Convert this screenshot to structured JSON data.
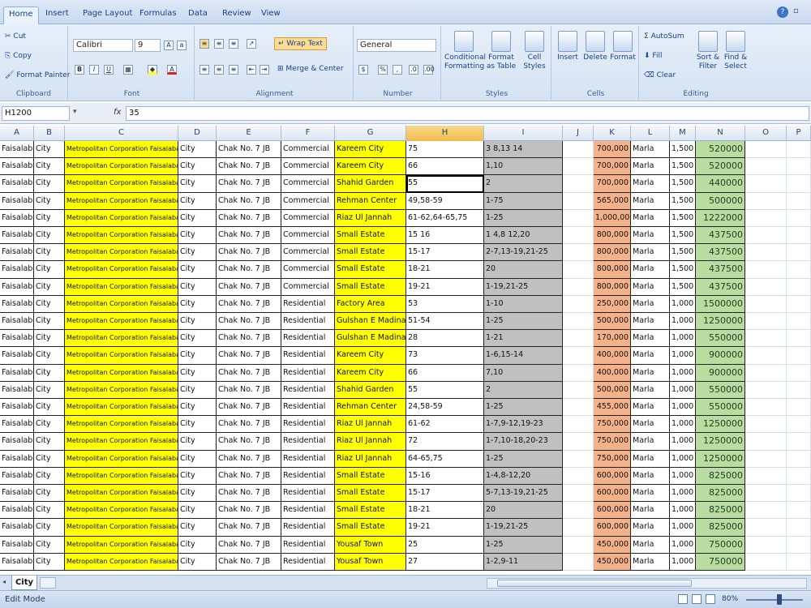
{
  "tabs": [
    "Home",
    "Insert",
    "Page Layout",
    "Formulas",
    "Data",
    "Review",
    "View"
  ],
  "ribbon": {
    "clipboard": {
      "cut": "Cut",
      "copy": "Copy",
      "format_painter": "Format Painter",
      "label": "Clipboard"
    },
    "font": {
      "name": "Calibri",
      "size": "9",
      "label": "Font"
    },
    "alignment": {
      "wrap": "Wrap Text",
      "merge": "Merge & Center",
      "label": "Alignment"
    },
    "number": {
      "format": "General",
      "label": "Number"
    },
    "styles": {
      "conditional": "Conditional Formatting",
      "format_table": "Format as Table",
      "cell_styles": "Cell Styles",
      "label": "Styles"
    },
    "cells": {
      "insert": "Insert",
      "delete": "Delete",
      "format": "Format",
      "label": "Cells"
    },
    "editing": {
      "autosum": "AutoSum",
      "fill": "Fill",
      "clear": "Clear",
      "sort": "Sort & Filter",
      "find": "Find & Select",
      "label": "Editing"
    }
  },
  "formula_bar": {
    "name_box": "H1200",
    "fx": "fx",
    "content": "35"
  },
  "columns": [
    "A",
    "B",
    "C",
    "D",
    "E",
    "F",
    "G",
    "H",
    "I",
    "J",
    "K",
    "L",
    "M",
    "N",
    "O",
    "P"
  ],
  "selected_column": "H",
  "rows": [
    {
      "a": "Faisalabad",
      "b": "City",
      "c": "Metropolitan Corporation Faisalabad",
      "d": "City",
      "e": "Chak No. 7 JB",
      "f": "Commercial",
      "g": "Kareem City",
      "h": "75",
      "i": "3 8,13 14",
      "k": "700,000",
      "l": "Marla",
      "m": "1,500",
      "n": "520000"
    },
    {
      "a": "Faisalabad",
      "b": "City",
      "c": "Metropolitan Corporation Faisalabad",
      "d": "City",
      "e": "Chak No. 7 JB",
      "f": "Commercial",
      "g": "Kareem City",
      "h": "66",
      "i": "1,10",
      "k": "700,000",
      "l": "Marla",
      "m": "1,500",
      "n": "520000"
    },
    {
      "a": "Faisalabad",
      "b": "City",
      "c": "Metropolitan Corporation Faisalabad",
      "d": "City",
      "e": "Chak No. 7 JB",
      "f": "Commercial",
      "g": "Shahid Garden",
      "h": "55",
      "i": "2",
      "k": "700,000",
      "l": "Marla",
      "m": "1,500",
      "n": "440000"
    },
    {
      "a": "Faisalabad",
      "b": "City",
      "c": "Metropolitan Corporation Faisalabad",
      "d": "City",
      "e": "Chak No. 7 JB",
      "f": "Commercial",
      "g": "Rehman Center",
      "h": "49,58-59",
      "i": "1-75",
      "k": "565,000",
      "l": "Marla",
      "m": "1,500",
      "n": "500000"
    },
    {
      "a": "Faisalabad",
      "b": "City",
      "c": "Metropolitan Corporation Faisalabad",
      "d": "City",
      "e": "Chak No. 7 JB",
      "f": "Commercial",
      "g": "Riaz Ul Jannah",
      "h": "61-62,64-65,75",
      "i": "1-25",
      "k": "1,000,000",
      "l": "Marla",
      "m": "1,500",
      "n": "1222000"
    },
    {
      "a": "Faisalabad",
      "b": "City",
      "c": "Metropolitan Corporation Faisalabad",
      "d": "City",
      "e": "Chak No. 7 JB",
      "f": "Commercial",
      "g": "Small Estate",
      "h": "15 16",
      "i": "1 4,8 12,20",
      "k": "800,000",
      "l": "Marla",
      "m": "1,500",
      "n": "437500"
    },
    {
      "a": "Faisalabad",
      "b": "City",
      "c": "Metropolitan Corporation Faisalabad",
      "d": "City",
      "e": "Chak No. 7 JB",
      "f": "Commercial",
      "g": "Small Estate",
      "h": "15-17",
      "i": "2-7,13-19,21-25",
      "k": "800,000",
      "l": "Marla",
      "m": "1,500",
      "n": "437500"
    },
    {
      "a": "Faisalabad",
      "b": "City",
      "c": "Metropolitan Corporation Faisalabad",
      "d": "City",
      "e": "Chak No. 7 JB",
      "f": "Commercial",
      "g": "Small Estate",
      "h": "18-21",
      "i": "20",
      "k": "800,000",
      "l": "Marla",
      "m": "1,500",
      "n": "437500"
    },
    {
      "a": "Faisalabad",
      "b": "City",
      "c": "Metropolitan Corporation Faisalabad",
      "d": "City",
      "e": "Chak No. 7 JB",
      "f": "Commercial",
      "g": "Small Estate",
      "h": "19-21",
      "i": "1-19,21-25",
      "k": "800,000",
      "l": "Marla",
      "m": "1,500",
      "n": "437500"
    },
    {
      "a": "Faisalabad",
      "b": "City",
      "c": "Metropolitan Corporation Faisalabad",
      "d": "City",
      "e": "Chak No. 7 JB",
      "f": "Residential",
      "g": "Factory Area",
      "h": "53",
      "i": "1-10",
      "k": "250,000",
      "l": "Marla",
      "m": "1,000",
      "n": "1500000"
    },
    {
      "a": "Faisalabad",
      "b": "City",
      "c": "Metropolitan Corporation Faisalabad",
      "d": "City",
      "e": "Chak No. 7 JB",
      "f": "Residential",
      "g": "Gulshan E Madina",
      "h": "51-54",
      "i": "1-25",
      "k": "500,000",
      "l": "Marla",
      "m": "1,000",
      "n": "1250000"
    },
    {
      "a": "Faisalabad",
      "b": "City",
      "c": "Metropolitan Corporation Faisalabad",
      "d": "City",
      "e": "Chak No. 7 JB",
      "f": "Residential",
      "g": "Gulshan E Madina",
      "h": "28",
      "i": "1-21",
      "k": "170,000",
      "l": "Marla",
      "m": "1,000",
      "n": "550000"
    },
    {
      "a": "Faisalabad",
      "b": "City",
      "c": "Metropolitan Corporation Faisalabad",
      "d": "City",
      "e": "Chak No. 7 JB",
      "f": "Residential",
      "g": "Kareem City",
      "h": "73",
      "i": "1-6,15-14",
      "k": "400,000",
      "l": "Marla",
      "m": "1,000",
      "n": "900000"
    },
    {
      "a": "Faisalabad",
      "b": "City",
      "c": "Metropolitan Corporation Faisalabad",
      "d": "City",
      "e": "Chak No. 7 JB",
      "f": "Residential",
      "g": "Kareem City",
      "h": "66",
      "i": "7,10",
      "k": "400,000",
      "l": "Marla",
      "m": "1,000",
      "n": "900000"
    },
    {
      "a": "Faisalabad",
      "b": "City",
      "c": "Metropolitan Corporation Faisalabad",
      "d": "City",
      "e": "Chak No. 7 JB",
      "f": "Residential",
      "g": "Shahid Garden",
      "h": "55",
      "i": "2",
      "k": "500,000",
      "l": "Marla",
      "m": "1,000",
      "n": "550000"
    },
    {
      "a": "Faisalabad",
      "b": "City",
      "c": "Metropolitan Corporation Faisalabad",
      "d": "City",
      "e": "Chak No. 7 JB",
      "f": "Residential",
      "g": "Rehman Center",
      "h": "24,58-59",
      "i": "1-25",
      "k": "455,000",
      "l": "Marla",
      "m": "1,000",
      "n": "550000"
    },
    {
      "a": "Faisalabad",
      "b": "City",
      "c": "Metropolitan Corporation Faisalabad",
      "d": "City",
      "e": "Chak No. 7 JB",
      "f": "Residential",
      "g": "Riaz Ul Jannah",
      "h": "61-62",
      "i": "1-7,9-12,19-23",
      "k": "750,000",
      "l": "Marla",
      "m": "1,000",
      "n": "1250000"
    },
    {
      "a": "Faisalabad",
      "b": "City",
      "c": "Metropolitan Corporation Faisalabad",
      "d": "City",
      "e": "Chak No. 7 JB",
      "f": "Residential",
      "g": "Riaz Ul Jannah",
      "h": "72",
      "i": "1-7,10-18,20-23",
      "k": "750,000",
      "l": "Marla",
      "m": "1,000",
      "n": "1250000"
    },
    {
      "a": "Faisalabad",
      "b": "City",
      "c": "Metropolitan Corporation Faisalabad",
      "d": "City",
      "e": "Chak No. 7 JB",
      "f": "Residential",
      "g": "Riaz Ul Jannah",
      "h": "64-65,75",
      "i": "1-25",
      "k": "750,000",
      "l": "Marla",
      "m": "1,000",
      "n": "1250000"
    },
    {
      "a": "Faisalabad",
      "b": "City",
      "c": "Metropolitan Corporation Faisalabad",
      "d": "City",
      "e": "Chak No. 7 JB",
      "f": "Residential",
      "g": "Small Estate",
      "h": "15-16",
      "i": "1-4,8-12,20",
      "k": "600,000",
      "l": "Marla",
      "m": "1,000",
      "n": "825000"
    },
    {
      "a": "Faisalabad",
      "b": "City",
      "c": "Metropolitan Corporation Faisalabad",
      "d": "City",
      "e": "Chak No. 7 JB",
      "f": "Residential",
      "g": "Small Estate",
      "h": "15-17",
      "i": "5-7,13-19,21-25",
      "k": "600,000",
      "l": "Marla",
      "m": "1,000",
      "n": "825000"
    },
    {
      "a": "Faisalabad",
      "b": "City",
      "c": "Metropolitan Corporation Faisalabad",
      "d": "City",
      "e": "Chak No. 7 JB",
      "f": "Residential",
      "g": "Small Estate",
      "h": "18-21",
      "i": "20",
      "k": "600,000",
      "l": "Marla",
      "m": "1,000",
      "n": "825000"
    },
    {
      "a": "Faisalabad",
      "b": "City",
      "c": "Metropolitan Corporation Faisalabad",
      "d": "City",
      "e": "Chak No. 7 JB",
      "f": "Residential",
      "g": "Small Estate",
      "h": "19-21",
      "i": "1-19,21-25",
      "k": "600,000",
      "l": "Marla",
      "m": "1,000",
      "n": "825000"
    },
    {
      "a": "Faisalabad",
      "b": "City",
      "c": "Metropolitan Corporation Faisalabad",
      "d": "City",
      "e": "Chak No. 7 JB",
      "f": "Residential",
      "g": "Yousaf Town",
      "h": "25",
      "i": "1-25",
      "k": "450,000",
      "l": "Marla",
      "m": "1,000",
      "n": "750000"
    },
    {
      "a": "Faisalabad",
      "b": "City",
      "c": "Metropolitan Corporation Faisalabad",
      "d": "City",
      "e": "Chak No. 7 JB",
      "f": "Residential",
      "g": "Yousaf Town",
      "h": "27",
      "i": "1-2,9-11",
      "k": "450,000",
      "l": "Marla",
      "m": "1,000",
      "n": "750000"
    }
  ],
  "active_row_index": 2,
  "sheet_tab": "City",
  "status": {
    "mode": "Edit Mode",
    "zoom": "80%"
  },
  "colors": {
    "yellow": "#ffff00",
    "gray": "#c0c0c0",
    "orange": "#f4b28a",
    "green": "#b9dca1",
    "selected_header": "#f1b94d"
  }
}
